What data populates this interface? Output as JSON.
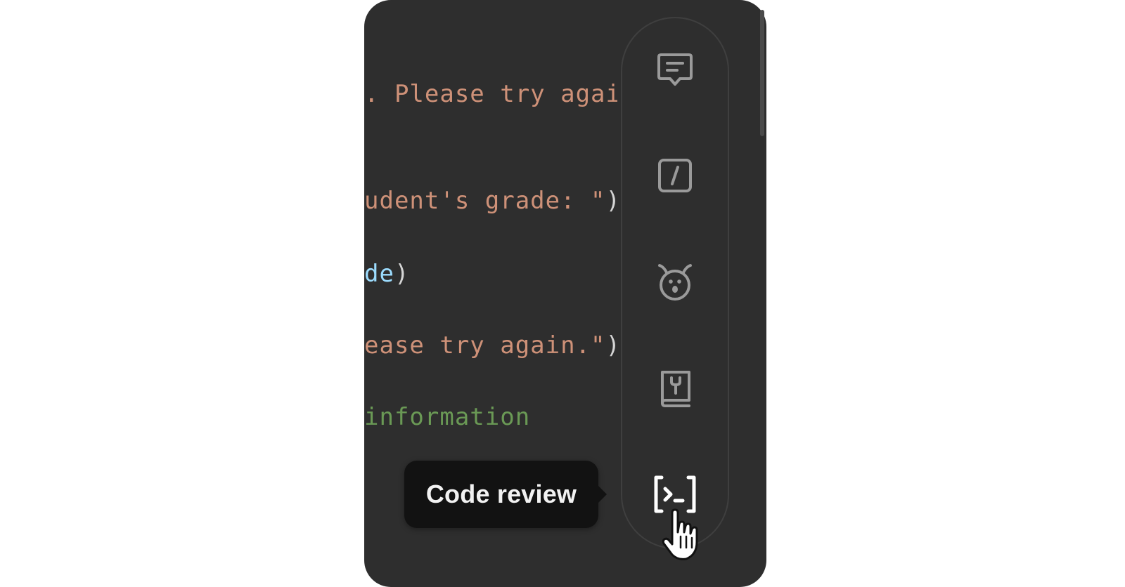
{
  "code_lines": [
    {
      "parts": [
        {
          "text": ". Please try again",
          "kind": "string"
        }
      ]
    },
    {
      "parts": [
        {
          "text": "udent's grade: \"",
          "kind": "string"
        },
        {
          "text": ")",
          "kind": "punct"
        }
      ]
    },
    {
      "parts": [
        {
          "text": "de",
          "kind": "var"
        },
        {
          "text": ")",
          "kind": "punct"
        }
      ]
    },
    {
      "parts": [
        {
          "text": "ease try again.\"",
          "kind": "string"
        },
        {
          "text": ")",
          "kind": "punct"
        }
      ]
    },
    {
      "parts": [
        {
          "text": "information",
          "kind": "comment"
        }
      ]
    }
  ],
  "toolbar": {
    "items": [
      {
        "icon": "chat-message-icon"
      },
      {
        "icon": "slash-command-icon"
      },
      {
        "icon": "bug-icon"
      },
      {
        "icon": "book-tools-icon"
      },
      {
        "icon": "terminal-bracket-icon",
        "active": true
      }
    ]
  },
  "tooltip": {
    "label": "Code review"
  },
  "colors": {
    "panel_bg": "#2e2e2e",
    "string": "#ce9178",
    "variable": "#9cdcfe",
    "punctuation": "#d4d4d4",
    "comment": "#6a9955",
    "icon_idle": "#9a9a9a",
    "icon_active": "#ffffff",
    "tooltip_bg": "#121212"
  }
}
